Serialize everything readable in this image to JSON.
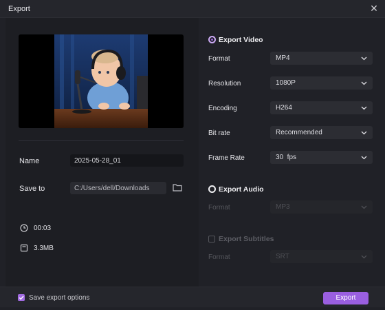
{
  "window": {
    "title": "Export",
    "close_icon": "close-icon"
  },
  "left": {
    "name_label": "Name",
    "name_value": "2025-05-28_01",
    "save_label": "Save to",
    "save_value": "C:/Users/dell/Downloads",
    "duration": "00:03",
    "size": "3.3MB"
  },
  "export_video": {
    "label": "Export Video",
    "selected": true,
    "format_label": "Format",
    "format_value": "MP4",
    "resolution_label": "Resolution",
    "resolution_value": "1080P",
    "encoding_label": "Encoding",
    "encoding_value": "H264",
    "bitrate_label": "Bit rate",
    "bitrate_value": "Recommended",
    "framerate_label": "Frame Rate",
    "framerate_value": "30  fps"
  },
  "export_audio": {
    "label": "Export Audio",
    "selected": false,
    "format_label": "Format",
    "format_value": "MP3"
  },
  "export_subtitles": {
    "label": "Export Subtitles",
    "checked": false,
    "format_label": "Format",
    "format_value": "SRT"
  },
  "footer": {
    "save_options_label": "Save export options",
    "save_options_checked": true,
    "export_button": "Export"
  },
  "colors": {
    "accent": "#9a5fe0",
    "panel": "#202127",
    "field": "#2c2d33"
  }
}
